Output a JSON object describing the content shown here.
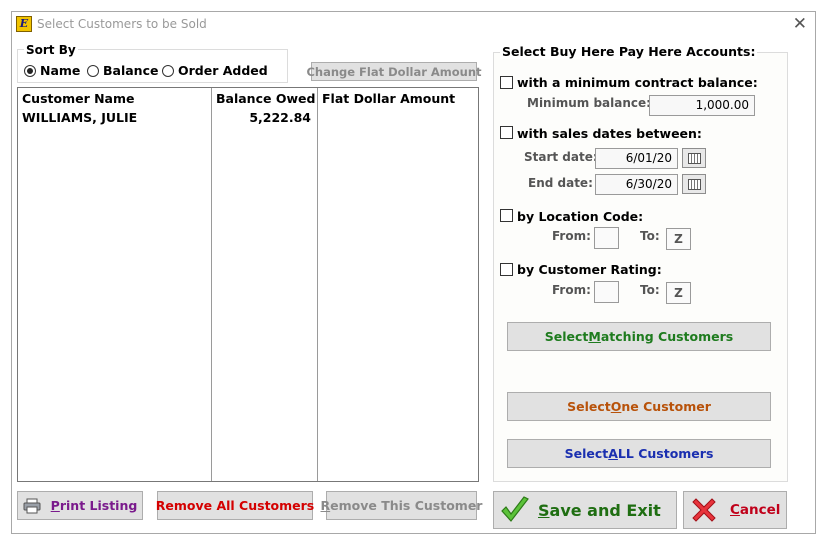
{
  "window": {
    "title": "Select Customers to be Sold",
    "app_icon_letter": "E"
  },
  "sort_by": {
    "label": "Sort By",
    "options": [
      {
        "label": "Name",
        "selected": true
      },
      {
        "label": "Balance",
        "selected": false
      },
      {
        "label": "Order Added",
        "selected": false
      }
    ]
  },
  "change_flat_button": "Change Flat Dollar Amount",
  "table": {
    "columns": [
      "Customer Name",
      "Balance Owed",
      "Flat Dollar Amount"
    ],
    "rows": [
      {
        "name": "WILLIAMS, JULIE",
        "balance": "5,222.84",
        "flat": ""
      }
    ]
  },
  "filters": {
    "heading": "Select Buy Here Pay Here Accounts:",
    "min_balance": {
      "checkbox_label": "with a minimum contract balance:",
      "checked": false,
      "field_label": "Minimum balance:",
      "value": "1,000.00"
    },
    "sales_dates": {
      "checkbox_label": "with sales dates between:",
      "checked": false,
      "start_label": "Start date:",
      "start_value": "6/01/20",
      "end_label": "End date:",
      "end_value": "6/30/20"
    },
    "location": {
      "checkbox_label": "by Location Code:",
      "checked": false,
      "from_label": "From:",
      "from_value": "",
      "to_label": "To:",
      "to_value": "Z"
    },
    "rating": {
      "checkbox_label": "by Customer Rating:",
      "checked": false,
      "from_label": "From:",
      "from_value": "",
      "to_label": "To:",
      "to_value": "Z"
    }
  },
  "buttons": {
    "select_matching": {
      "pre": "Select ",
      "key": "M",
      "post": "atching Customers"
    },
    "select_one": {
      "pre": "Select ",
      "key": "O",
      "post": "ne Customer"
    },
    "select_all": {
      "pre": "Select ",
      "key": "A",
      "post": "LL Customers"
    },
    "print_listing": {
      "pre": "",
      "key": "P",
      "post": "rint Listing"
    },
    "remove_all": "Remove All Customers",
    "remove_this": {
      "pre": "",
      "key": "R",
      "post": "emove This Customer"
    },
    "save_exit": {
      "pre": "",
      "key": "S",
      "post": "ave and Exit"
    },
    "cancel": {
      "pre": "",
      "key": "C",
      "post": "ancel"
    }
  },
  "colors": {
    "matching": "#1e7b1e",
    "one": "#b8520a",
    "all": "#1a2fb0",
    "print": "#7a1a8c",
    "remove_all": "#d40000",
    "disabled": "#8a8a8a",
    "save": "#1f6e12",
    "cancel": "#c0001a"
  }
}
